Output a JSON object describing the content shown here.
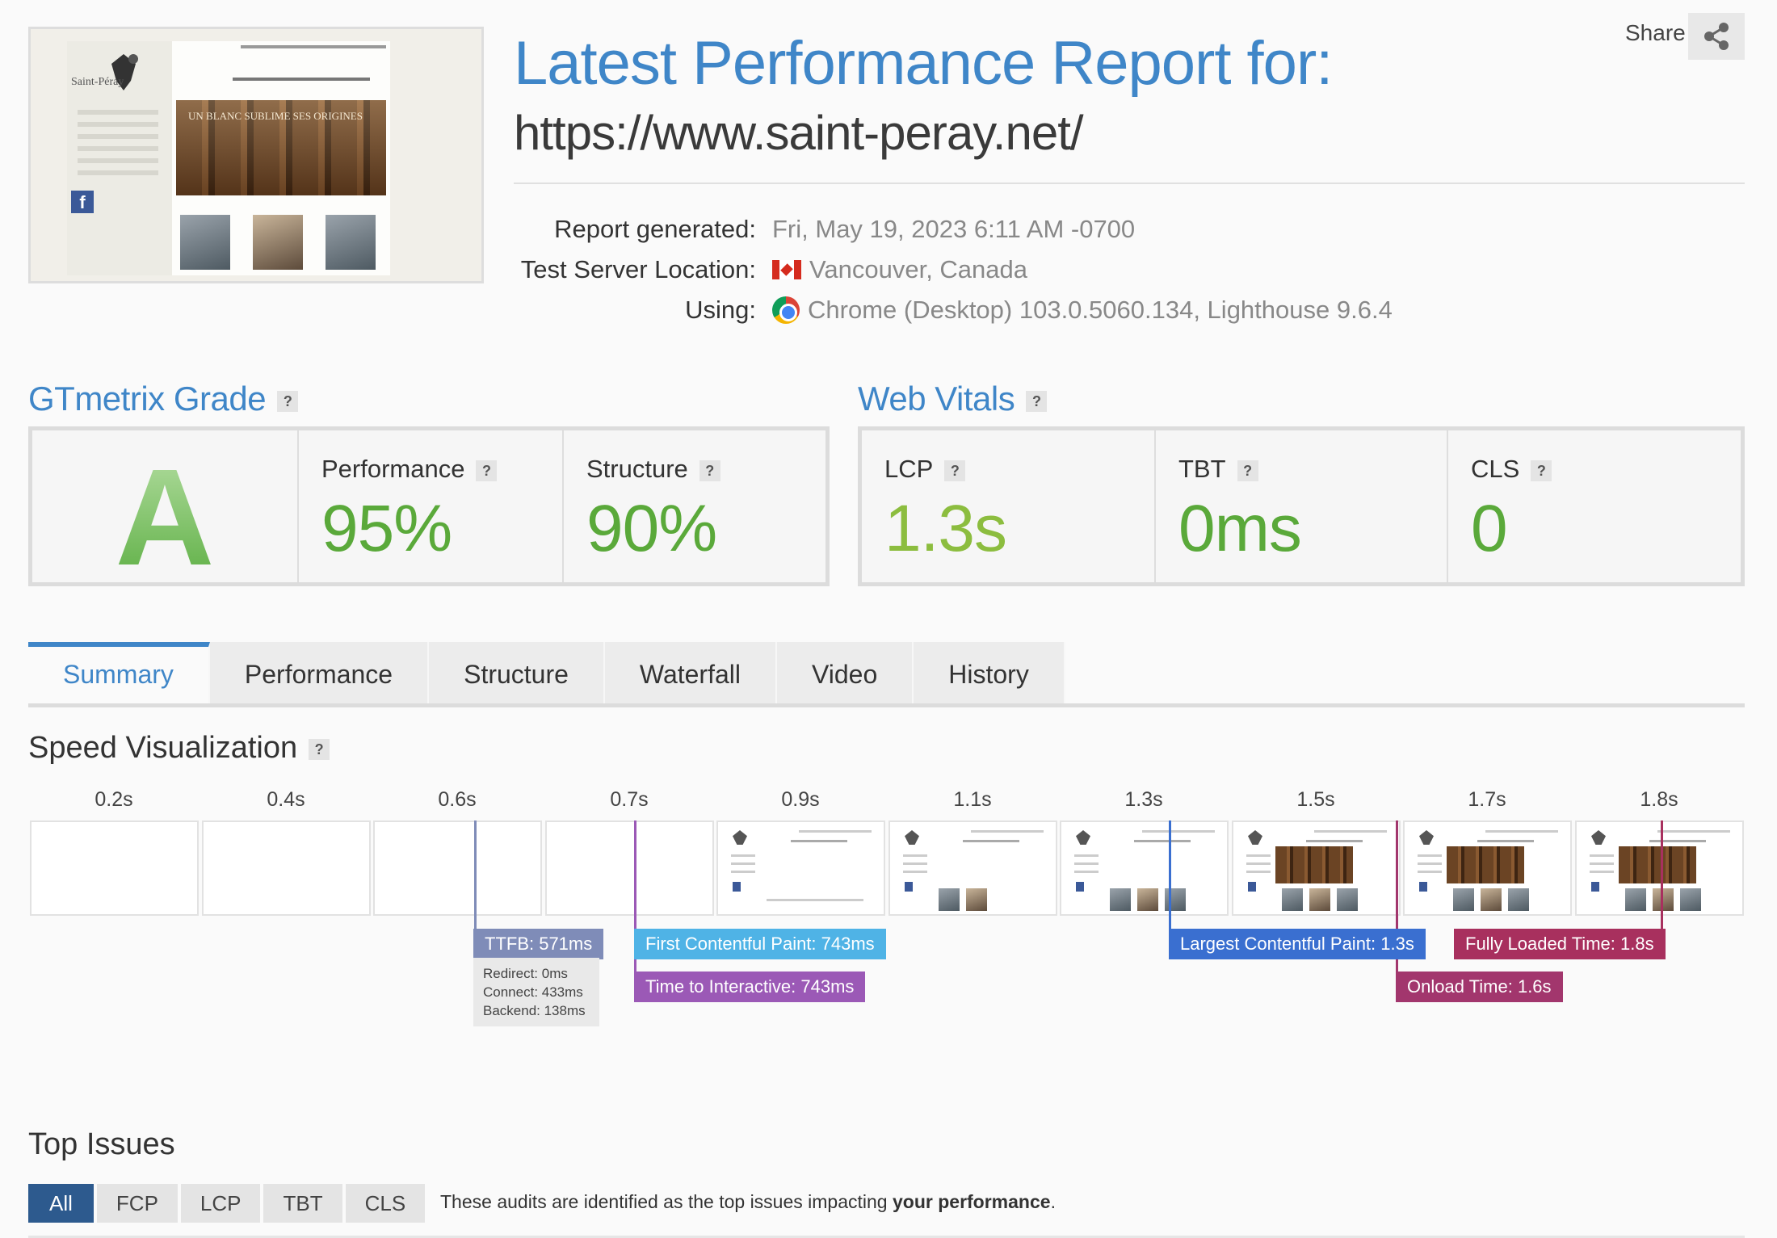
{
  "header": {
    "title": "Latest Performance Report for:",
    "url": "https://www.saint-peray.net/",
    "share_label": "Share",
    "thumbnail": {
      "site_name": "Saint-Péray",
      "banner_text": "UN BLANC SUBLIME SES ORIGINES",
      "facebook_glyph": "f"
    },
    "meta": [
      {
        "label": "Report generated:",
        "value": "Fri, May 19, 2023 6:11 AM -0700",
        "icon": ""
      },
      {
        "label": "Test Server Location:",
        "value": "Vancouver, Canada",
        "icon": "canada-flag-icon"
      },
      {
        "label": "Using:",
        "value": "Chrome (Desktop) 103.0.5060.134, Lighthouse 9.6.4",
        "icon": "chrome-icon"
      }
    ]
  },
  "gtmetrix": {
    "title": "GTmetrix Grade",
    "help": "?",
    "grade": "A",
    "performance": {
      "label": "Performance",
      "value": "95%"
    },
    "structure": {
      "label": "Structure",
      "value": "90%"
    }
  },
  "web_vitals": {
    "title": "Web Vitals",
    "help": "?",
    "lcp": {
      "label": "LCP",
      "value": "1.3s"
    },
    "tbt": {
      "label": "TBT",
      "value": "0ms"
    },
    "cls": {
      "label": "CLS",
      "value": "0"
    }
  },
  "tabs": [
    "Summary",
    "Performance",
    "Structure",
    "Waterfall",
    "Video",
    "History"
  ],
  "active_tab": "Summary",
  "speed": {
    "title": "Speed Visualization",
    "help": "?",
    "time_labels": [
      "0.2s",
      "0.4s",
      "0.6s",
      "0.7s",
      "0.9s",
      "1.1s",
      "1.3s",
      "1.5s",
      "1.7s",
      "1.8s"
    ],
    "markers": {
      "ttfb": "TTFB: 571ms",
      "fcp": "First Contentful Paint: 743ms",
      "tti": "Time to Interactive: 743ms",
      "lcp": "Largest Contentful Paint: 1.3s",
      "fully_loaded": "Fully Loaded Time: 1.8s",
      "onload": "Onload Time: 1.6s"
    },
    "ttfb_details": [
      "Redirect: 0ms",
      "Connect: 433ms",
      "Backend: 138ms"
    ]
  },
  "issues": {
    "title": "Top Issues",
    "filters": [
      "All",
      "FCP",
      "LCP",
      "TBT",
      "CLS"
    ],
    "description_prefix": "These audits are identified as the top issues impacting ",
    "description_bold": "your performance",
    "description_suffix": "."
  },
  "colors": {
    "accent": "#3f86c8",
    "good": "#5aa93a",
    "ttfb": "#7f8cb8",
    "fcp": "#4fb3e6",
    "tti": "#9b59b6",
    "lcp": "#3a6fd0",
    "onload": "#a2366d",
    "fully_loaded": "#a8305e"
  }
}
